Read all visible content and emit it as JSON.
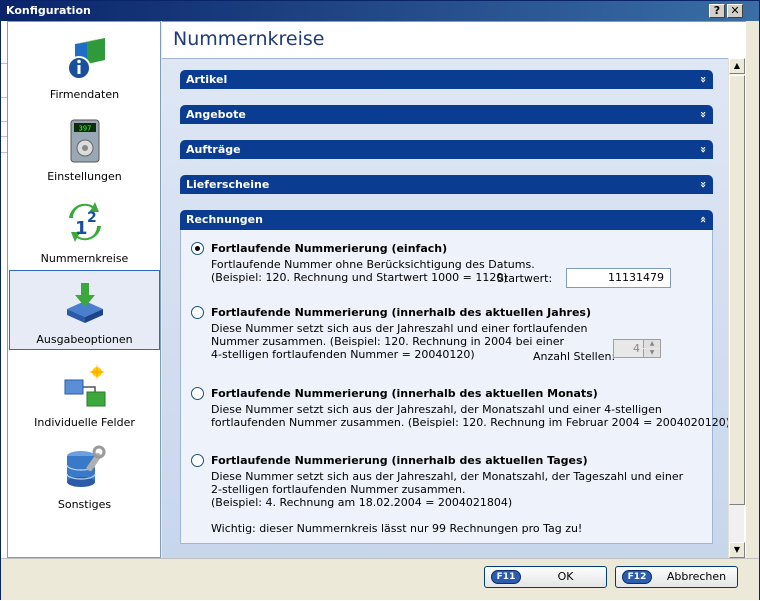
{
  "window": {
    "title": "Konfiguration",
    "help_label": "?",
    "close_label": "✕"
  },
  "sidebar": {
    "items": [
      {
        "label": "Firmendaten",
        "icon": "info-icon"
      },
      {
        "label": "Einstellungen",
        "icon": "display-device-icon"
      },
      {
        "label": "Nummernkreise",
        "icon": "number-cycle-icon"
      },
      {
        "label": "Ausgabeoptionen",
        "icon": "output-tray-icon"
      },
      {
        "label": "Individuelle Felder",
        "icon": "custom-fields-icon"
      },
      {
        "label": "Sonstiges",
        "icon": "database-icon"
      }
    ],
    "active_index": 3
  },
  "main": {
    "title": "Nummernkreise",
    "sections": [
      {
        "label": "Artikel",
        "expanded": false
      },
      {
        "label": "Angebote",
        "expanded": false
      },
      {
        "label": "Aufträge",
        "expanded": false
      },
      {
        "label": "Lieferscheine",
        "expanded": false
      },
      {
        "label": "Rechnungen",
        "expanded": true
      }
    ],
    "chevron_down": "»",
    "chevron_up": "«",
    "options": [
      {
        "title": "Fortlaufende Nummerierung (einfach)",
        "selected": true,
        "lines": [
          "Fortlaufende Nummer ohne Berücksichtigung des Datums.",
          "(Beispiel: 120. Rechnung und Startwert 1000 = 1120)"
        ]
      },
      {
        "title": "Fortlaufende Nummerierung (innerhalb des aktuellen Jahres)",
        "selected": false,
        "lines": [
          "Diese Nummer setzt sich aus der Jahreszahl und einer fortlaufenden",
          "Nummer zusammen. (Beispiel: 120. Rechnung in 2004 bei einer",
          "4-stelligen fortlaufenden Nummer = 20040120)"
        ]
      },
      {
        "title": "Fortlaufende Nummerierung (innerhalb des aktuellen Monats)",
        "selected": false,
        "lines": [
          "Diese Nummer setzt sich aus der Jahreszahl, der Monatszahl und einer 4-stelligen",
          "fortlaufenden Nummer zusammen. (Beispiel: 120. Rechnung im Februar 2004 = 2004020120)"
        ]
      },
      {
        "title": "Fortlaufende Nummerierung (innerhalb des aktuellen Tages)",
        "selected": false,
        "lines": [
          "Diese Nummer setzt sich aus der Jahreszahl, der Monatszahl, der Tageszahl und einer",
          "2-stelligen fortlaufenden Nummer zusammen.",
          "(Beispiel: 4. Rechnung am 18.02.2004 = 2004021804)",
          "",
          "Wichtig: dieser Nummernkreis lässt nur 99 Rechnungen pro Tag zu!"
        ]
      }
    ],
    "startwert": {
      "label": "Startwert:",
      "value": "11131479"
    },
    "stellen": {
      "label": "Anzahl Stellen:",
      "value": "4"
    }
  },
  "footer": {
    "ok": {
      "key": "F11",
      "label": "OK"
    },
    "cancel": {
      "key": "F12",
      "label": "Abbrechen"
    }
  },
  "colors": {
    "section_header": "#0a3d91",
    "title_blue": "#1f3b7a",
    "titlebar": "#0a246a"
  }
}
